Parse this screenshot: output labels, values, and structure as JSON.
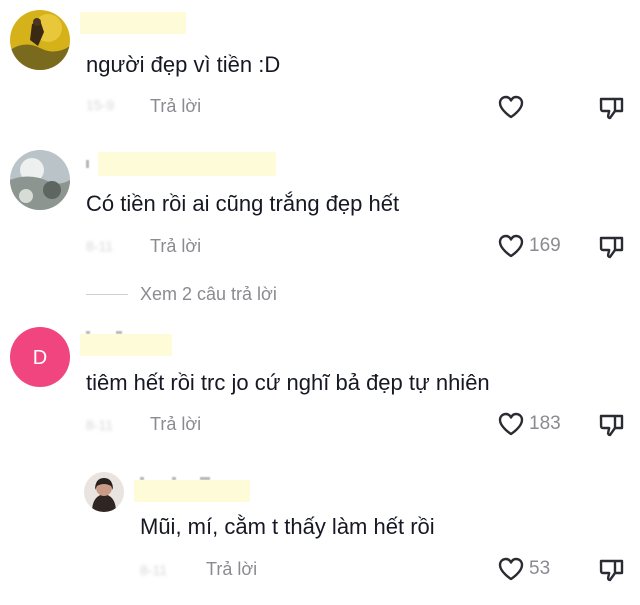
{
  "comments": [
    {
      "text": "người đẹp vì tiền :D",
      "date": "15-9",
      "reply_label": "Trả lời",
      "likes": ""
    },
    {
      "text": "Có tiền rồi ai cũng trắng đẹp hết",
      "date": "8-11",
      "reply_label": "Trả lời",
      "likes": "169"
    },
    {
      "text": "tiêm hết rồi trc jo cứ nghĩ bả đẹp tự nhiên",
      "date": "8-11",
      "reply_label": "Trả lời",
      "likes": "183",
      "avatar_letter": "D"
    },
    {
      "text": "Mũi, mí, cằm t thấy làm hết rồi",
      "date": "8-11",
      "reply_label": "Trả lời",
      "likes": "53"
    }
  ],
  "view_replies_label": "Xem 2 câu trả lời",
  "colors": {
    "text": "#161823",
    "muted": "#8a8b91",
    "avatar_pink": "#f0457e",
    "name_highlight": "#fdfbd8"
  },
  "icons": [
    "heart-icon",
    "dislike-icon"
  ]
}
